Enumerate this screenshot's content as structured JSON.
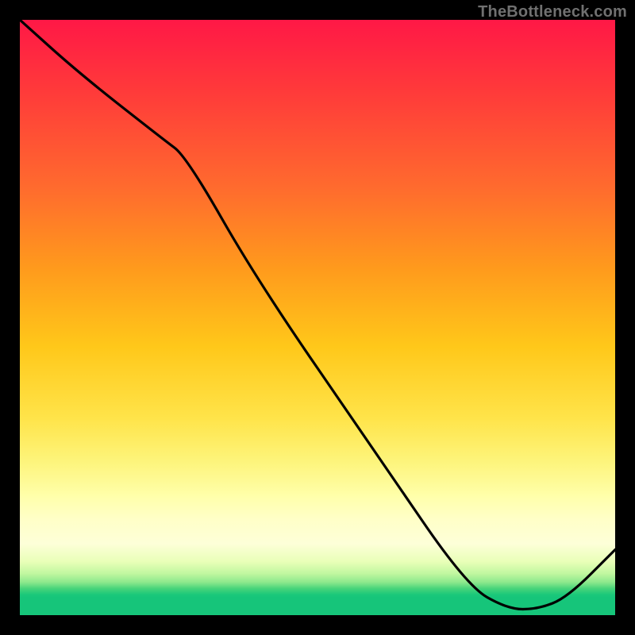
{
  "watermark": "TheBottleneck.com",
  "bottom_label": {
    "text": "",
    "x_pct": 75.5,
    "y_pct": 94.8
  },
  "chart_data": {
    "type": "line",
    "title": "",
    "xlabel": "",
    "ylabel": "",
    "xlim": [
      0,
      100
    ],
    "ylim": [
      0,
      100
    ],
    "grid": false,
    "legend": false,
    "background_gradient": "red-to-green, vertical, representing bottleneck severity (top=high, bottom=none)",
    "series": [
      {
        "name": "bottleneck-curve",
        "x": [
          0,
          10,
          24,
          28,
          40,
          60,
          75,
          82,
          87,
          92,
          100
        ],
        "values": [
          100,
          91,
          80,
          77,
          56,
          27,
          5,
          1,
          1,
          3,
          11
        ]
      }
    ],
    "notes": "Values estimated from pixel heights; curve descends nearly linearly with a soft shoulder around x≈24–28, reaches minimum (~1) near x≈82–87, then rises toward x=100."
  },
  "colors": {
    "curve": "#000000",
    "watermark": "#707070",
    "label": "#c0392b"
  }
}
